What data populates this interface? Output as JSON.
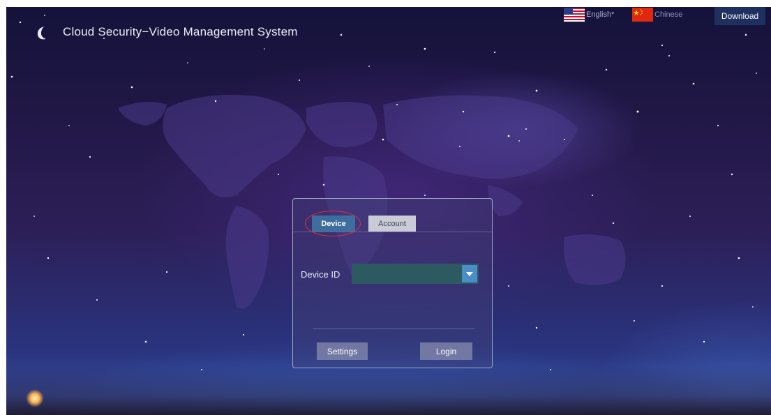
{
  "header": {
    "title": "Cloud Security−Video Management System",
    "logo_icon": "crescent-moon-icon"
  },
  "language": {
    "english_label": "English*",
    "english_flag": "us-flag-icon",
    "chinese_label": "Chinese",
    "chinese_flag": "china-flag-icon"
  },
  "download_label": "Download",
  "login": {
    "tabs": [
      {
        "label": "Device",
        "active": true
      },
      {
        "label": "Account",
        "active": false
      }
    ],
    "device_id_label": "Device ID",
    "device_id_value": "",
    "dropdown_icon": "caret-down-icon",
    "settings_label": "Settings",
    "login_label": "Login"
  },
  "colors": {
    "active_tab": "#3e6e9e",
    "download_bg": "#1e3060",
    "highlight_ring": "#d43040",
    "select_bg": "#2d5a60",
    "select_arrow_bg": "#4a8ec8"
  }
}
